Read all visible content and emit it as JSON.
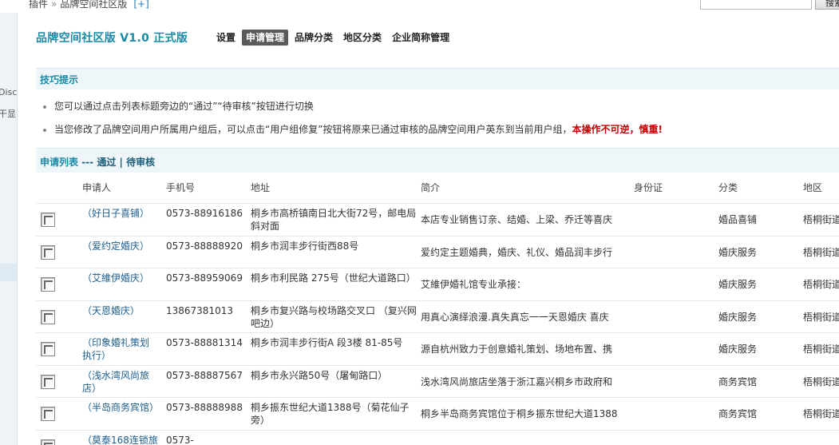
{
  "topbar": {
    "breadcrumb": [
      "插件",
      "品牌空间社区版"
    ],
    "breadcrumb_sep": "»",
    "add_link": "[+]",
    "search_placeholder": "",
    "search_button": "搜索"
  },
  "leftframe": {
    "texts": [
      "Disc",
      "干显:"
    ]
  },
  "app": {
    "title": "品牌空间社区版 V1.0 正式版",
    "tabs": [
      {
        "label": "设置",
        "active": false
      },
      {
        "label": "申请管理",
        "active": true
      },
      {
        "label": "品牌分类",
        "active": false
      },
      {
        "label": "地区分类",
        "active": false
      },
      {
        "label": "企业简称管理",
        "active": false
      }
    ]
  },
  "tips": {
    "title": "技巧提示",
    "items": [
      {
        "text": "您可以通过点击列表标题旁边的“通过”“待审核”按钮进行切换",
        "warn": ""
      },
      {
        "text": "当您修改了品牌空间用户所属用户组后，可以点击“用户组修复”按钮将原来已通过审核的品牌空间用户英东到当前用户组，",
        "warn": "本操作不可逆，慎重!"
      }
    ]
  },
  "list": {
    "title": "申请列表",
    "sep1": " --- ",
    "pass_link": "通过",
    "sep2": " | ",
    "pending_link": "待审核",
    "columns": [
      "申请人",
      "手机号",
      "地址",
      "简介",
      "身份证",
      "分类",
      "地区"
    ],
    "rows": [
      {
        "name": "（好日子喜铺）",
        "phone": "0573-88916186",
        "address": "桐乡市高桥镇南日北大街72号，邮电局斜对面",
        "intro": "本店专业销售订亲、结婚、上梁、乔迁等喜庆",
        "idcard": "",
        "category": "婚品喜铺",
        "region": "梧桐街道"
      },
      {
        "name": "（爱约定婚庆）",
        "phone": "0573-88888920",
        "address": "桐乡市润丰步行街西88号",
        "intro": "爱约定主题婚典，婚庆、礼仪、婚品润丰步行",
        "idcard": "",
        "category": "婚庆服务",
        "region": "梧桐街道"
      },
      {
        "name": "（艾維伊婚庆）",
        "phone": "0573-88959069",
        "address": "桐乡市利民路 275号（世纪大道路口）",
        "intro": "艾維伊婚礼馆专业承接：",
        "idcard": "",
        "category": "婚庆服务",
        "region": "梧桐街道"
      },
      {
        "name": "（天恩婚庆）",
        "phone": "13867381013",
        "address": "桐乡市复兴路与校场路交叉口 （复兴网吧边）",
        "intro": "用真心演绎浪漫.真失真忘一一天恩婚庆 喜庆",
        "idcard": "",
        "category": "婚庆服务",
        "region": "梧桐街道"
      },
      {
        "name": "（印象婚礼策划执行）",
        "phone": "0573-88881314",
        "address": "桐乡市润丰步行街A 段3楼 81-85号",
        "intro": "源自杭州致力于创意婚礼策划、场地布置、携",
        "idcard": "",
        "category": "婚庆服务",
        "region": "梧桐街道"
      },
      {
        "name": "（浅水湾风尚旅店）",
        "phone": "0573-88887567",
        "address": "桐乡市永兴路50号（屠甸路口）",
        "intro": "浅水湾风尚旅店坐落于浙江嘉兴桐乡市政府和",
        "idcard": "",
        "category": "商务宾馆",
        "region": "梧桐街道"
      },
      {
        "name": "（半岛商务宾馆）",
        "phone": "0573-88888988",
        "address": "桐乡振东世纪大道1388号（菊花仙子旁）",
        "intro": "桐乡半岛商务宾馆位于桐乡振东世纪大道1388",
        "idcard": "",
        "category": "商务宾馆",
        "region": "梧桐街道"
      },
      {
        "name": "（莫泰168连锁旅店）",
        "phone": "0573-",
        "address": "",
        "intro": "",
        "idcard": "",
        "category": "",
        "region": ""
      }
    ]
  }
}
